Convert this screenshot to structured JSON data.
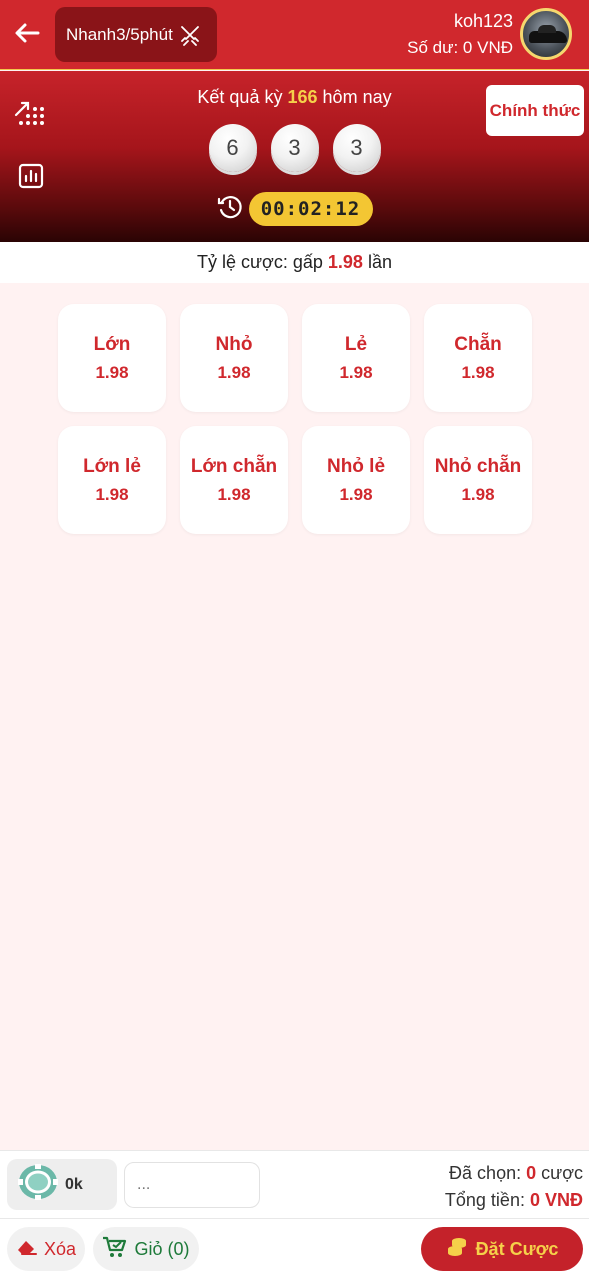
{
  "header": {
    "game_name": "Nhanh3/5phút",
    "username": "koh123",
    "balance": "Số dư: 0 VNĐ",
    "icons": {
      "back": "back-arrow-icon",
      "game": "crossed-swords-icon",
      "avatar": "car-avatar"
    }
  },
  "result": {
    "title_prefix": "Kết quả kỳ",
    "period": "166",
    "title_suffix": "hôm nay",
    "official_label": "Chính thức",
    "balls": [
      "6",
      "3",
      "3"
    ],
    "countdown": "00:02:12",
    "icons": {
      "trend": "trend-dots-icon",
      "stats": "bar-chart-icon",
      "history": "history-clock-icon"
    }
  },
  "ratio": {
    "prefix": "Tỷ lệ cược: gấp",
    "value": "1.98",
    "suffix": "lần"
  },
  "bets": [
    {
      "label": "Lớn",
      "odds": "1.98"
    },
    {
      "label": "Nhỏ",
      "odds": "1.98"
    },
    {
      "label": "Lẻ",
      "odds": "1.98"
    },
    {
      "label": "Chẵn",
      "odds": "1.98"
    },
    {
      "label": "Lớn lẻ",
      "odds": "1.98"
    },
    {
      "label": "Lớn chẵn",
      "odds": "1.98"
    },
    {
      "label": "Nhỏ lẻ",
      "odds": "1.98"
    },
    {
      "label": "Nhỏ chẵn",
      "odds": "1.98"
    }
  ],
  "footer": {
    "chip_amount": "0k",
    "amount_placeholder": "...",
    "selected_label": "Đã chọn:",
    "selected_count": "0",
    "selected_unit": "cược",
    "total_label": "Tổng tiền:",
    "total_value": "0 VNĐ",
    "clear_label": "Xóa",
    "cart_label": "Giỏ (0)",
    "place_bet_label": "Đặt Cược"
  },
  "colors": {
    "primary_red": "#d0282d",
    "gold": "#f3c633",
    "bg_pink": "#fff2f2",
    "green": "#1e7a3a"
  }
}
